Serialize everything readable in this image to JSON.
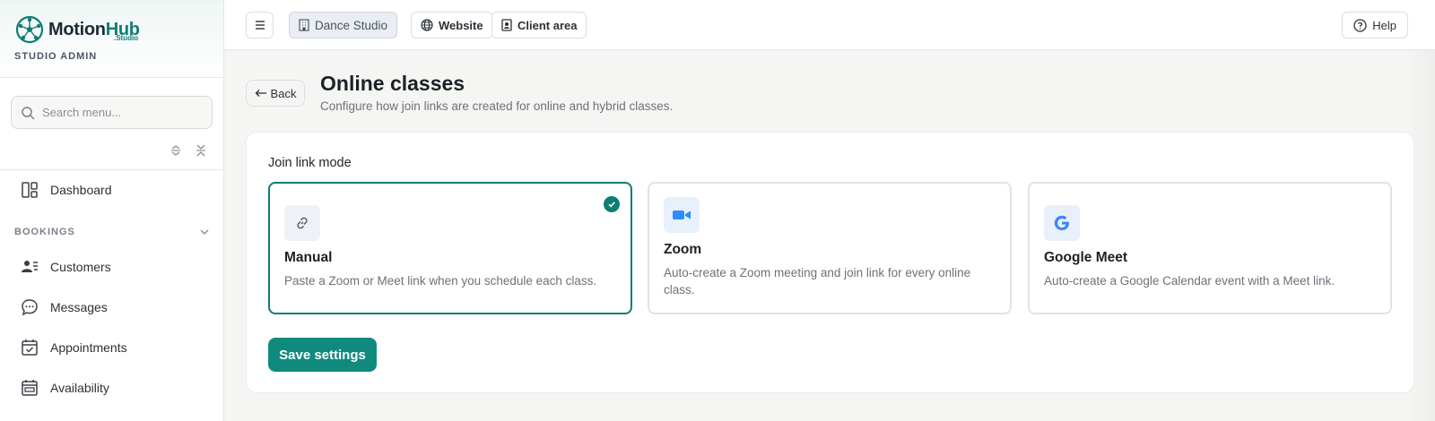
{
  "sidebar": {
    "brand": {
      "name_part1": "Motion",
      "name_part2": "Hub",
      "sub": ".Studio",
      "role": "STUDIO ADMIN"
    },
    "search": {
      "placeholder": "Search menu...",
      "value": ""
    },
    "items": [
      {
        "label": "Dashboard",
        "icon": "layout-icon"
      },
      {
        "label": "Customers",
        "icon": "users-list-icon"
      },
      {
        "label": "Messages",
        "icon": "chat-bubble-icon"
      },
      {
        "label": "Appointments",
        "icon": "calendar-check-icon"
      },
      {
        "label": "Availability",
        "icon": "calendar-table-icon"
      }
    ],
    "section": {
      "label": "BOOKINGS"
    }
  },
  "topbar": {
    "studio": "Dance Studio",
    "website": "Website",
    "client_area": "Client area",
    "help": "Help"
  },
  "page": {
    "back": "Back",
    "title": "Online classes",
    "subtitle": "Configure how join links are created for online and hybrid classes."
  },
  "settings": {
    "label": "Join link mode",
    "options": [
      {
        "title": "Manual",
        "description": "Paste a Zoom or Meet link when you schedule each class.",
        "selected": true,
        "icon": "link-icon"
      },
      {
        "title": "Zoom",
        "description": "Auto-create a Zoom meeting and join link for every online class.",
        "selected": false,
        "icon": "video-camera-icon"
      },
      {
        "title": "Google Meet",
        "description": "Auto-create a Google Calendar event with a Meet link.",
        "selected": false,
        "icon": "google-icon"
      }
    ],
    "save": "Save settings"
  },
  "colors": {
    "accent": "#118a7e",
    "selected_border": "#0f7d74",
    "zoom_blue": "#2d8cff",
    "google_blue": "#4285f4"
  }
}
